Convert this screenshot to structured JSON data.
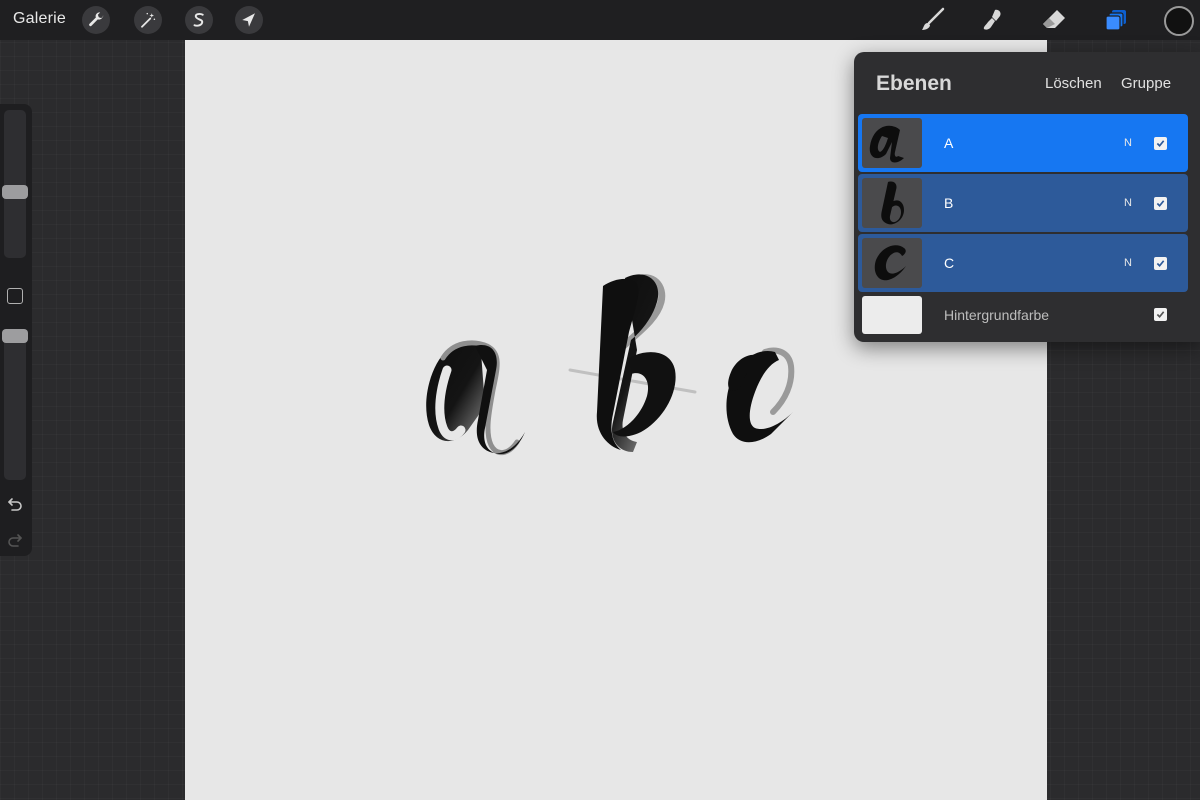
{
  "toolbar": {
    "gallery_label": "Galerie",
    "left_tools": [
      "wrench-icon",
      "magic-wand-icon",
      "selection-s-icon",
      "transform-arrow-icon"
    ],
    "right_tools": [
      "brush-icon",
      "smudge-icon",
      "eraser-icon",
      "layers-icon"
    ],
    "active_tool": "layers-icon",
    "accent_color": "#1677f2",
    "current_color": "#111111"
  },
  "sidebar": {
    "brush_size_level": 0.44,
    "opacity_level": 0.04,
    "icons": [
      "square-modify-icon",
      "undo-icon",
      "redo-icon"
    ]
  },
  "canvas": {
    "background_color": "#e7e7e7",
    "letters": [
      "a",
      "b",
      "c"
    ]
  },
  "layers": {
    "title": "Ebenen",
    "delete_label": "Löschen",
    "group_label": "Gruppe",
    "items": [
      {
        "name": "A",
        "thumb_letter": "a",
        "blend": "N",
        "visible": true,
        "state": "active"
      },
      {
        "name": "B",
        "thumb_letter": "b",
        "blend": "N",
        "visible": true,
        "state": "selected"
      },
      {
        "name": "C",
        "thumb_letter": "c",
        "blend": "N",
        "visible": true,
        "state": "selected"
      },
      {
        "name": "Hintergrundfarbe",
        "blend": "",
        "visible": true,
        "state": "plain"
      }
    ]
  }
}
